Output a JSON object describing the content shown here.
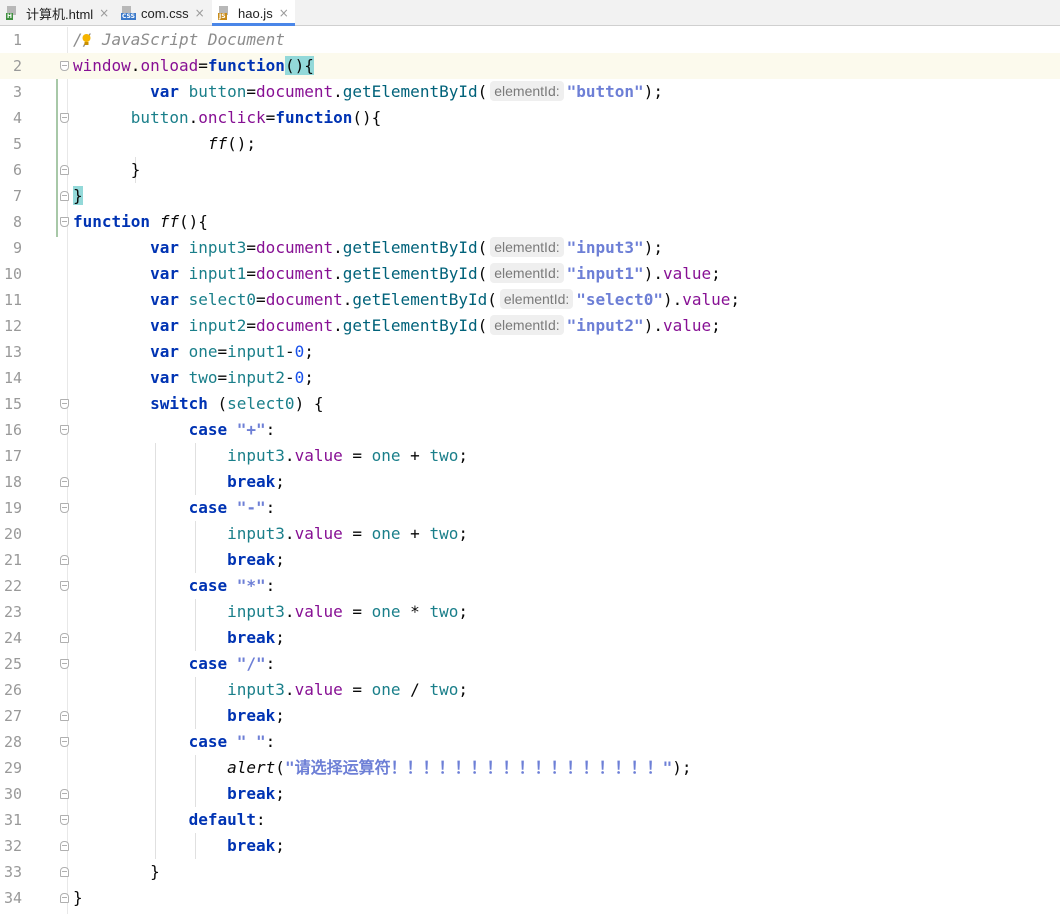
{
  "tabs": [
    {
      "label": "计算机.html",
      "badge": "H",
      "badge_color": "#3f8f3f",
      "active": false
    },
    {
      "label": "com.css",
      "badge": "CSS",
      "badge_color": "#3b79c9",
      "active": false
    },
    {
      "label": "hao.js",
      "badge": "JS",
      "badge_color": "#c78b1a",
      "active": true
    }
  ],
  "close_glyph": "×",
  "current_line": 2,
  "line_numbers": [
    "1",
    "2",
    "3",
    "4",
    "5",
    "6",
    "7",
    "8",
    "9",
    "10",
    "11",
    "12",
    "13",
    "14",
    "15",
    "16",
    "17",
    "18",
    "19",
    "20",
    "21",
    "22",
    "23",
    "24",
    "25",
    "26",
    "27",
    "28",
    "29",
    "30",
    "31",
    "32",
    "33",
    "34"
  ],
  "hint_label": "elementId:",
  "code": {
    "comment": "// JavaScript Document",
    "window": "window",
    "onload": "onload",
    "function": "function",
    "var": "var",
    "button": "button",
    "document": "document",
    "getElementById": "getElementById",
    "str_button": "\"button\"",
    "onclick": "onclick",
    "ff": "ff",
    "input3": "input3",
    "input1": "input1",
    "input2": "input2",
    "select0": "select0",
    "str_input3": "\"input3\"",
    "str_input1": "\"input1\"",
    "str_select0": "\"select0\"",
    "str_input2": "\"input2\"",
    "value": "value",
    "one": "one",
    "two": "two",
    "zero": "0",
    "switch": "switch",
    "case": "case",
    "break": "break",
    "default": "default",
    "str_plus": "\"+\"",
    "str_minus": "\"-\"",
    "str_times": "\"*\"",
    "str_div": "\"/\"",
    "str_space": "\" \"",
    "alert": "alert",
    "alert_msg": "\"请选择运算符！！！！！！！！！！！！！！！！！\""
  },
  "colors": {
    "keyword": "#0033b3",
    "variable": "#1a7f8a",
    "string": "#6d7fd6",
    "active_tab_underline": "#4a86e8",
    "current_line_bg": "#fcfaed",
    "brace_highlight": "#93d9d9"
  },
  "icons": [
    "html-file-icon",
    "css-file-icon",
    "js-file-icon",
    "close-icon",
    "fold-icon",
    "intention-bulb-icon"
  ]
}
